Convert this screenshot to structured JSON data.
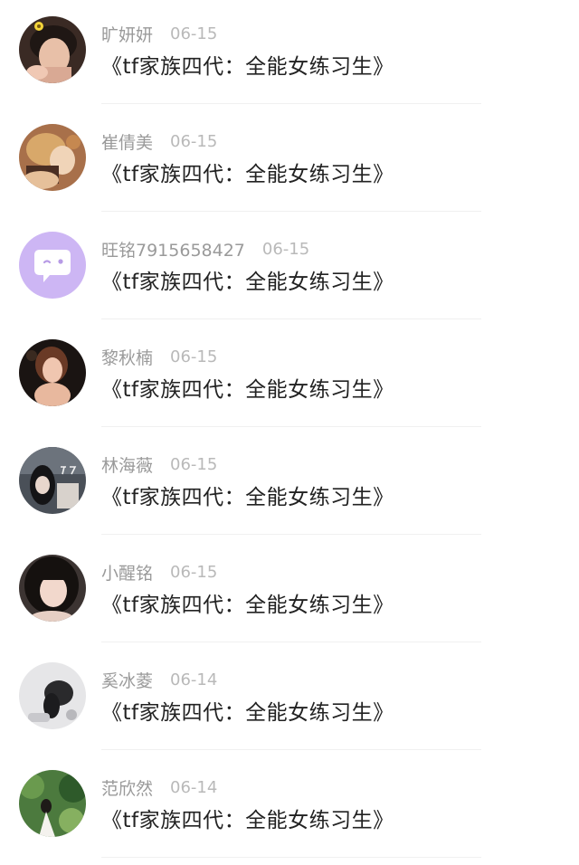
{
  "comments": [
    {
      "name": "旷妍妍",
      "date": "06-15",
      "title": "《tf家族四代：全能女练习生》",
      "avatar": "portrait-avatar"
    },
    {
      "name": "崔倩美",
      "date": "06-15",
      "title": "《tf家族四代：全能女练习生》",
      "avatar": "portrait-avatar"
    },
    {
      "name": "旺铭7915658427",
      "date": "06-15",
      "title": "《tf家族四代：全能女练习生》",
      "avatar": "default-chat-avatar"
    },
    {
      "name": "黎秋楠",
      "date": "06-15",
      "title": "《tf家族四代：全能女练习生》",
      "avatar": "portrait-avatar"
    },
    {
      "name": "林海薇",
      "date": "06-15",
      "title": "《tf家族四代：全能女练习生》",
      "avatar": "portrait-avatar"
    },
    {
      "name": "小醒铭",
      "date": "06-15",
      "title": "《tf家族四代：全能女练习生》",
      "avatar": "portrait-avatar"
    },
    {
      "name": "奚冰菱",
      "date": "06-14",
      "title": "《tf家族四代：全能女练习生》",
      "avatar": "portrait-avatar"
    },
    {
      "name": "范欣然",
      "date": "06-14",
      "title": "《tf家族四代：全能女练习生》",
      "avatar": "portrait-avatar"
    }
  ],
  "colors": {
    "default_avatar_bg": "#cdb6f4",
    "name_text": "#9a9a9a",
    "date_text": "#b9b9b9",
    "title_text": "#222222"
  }
}
